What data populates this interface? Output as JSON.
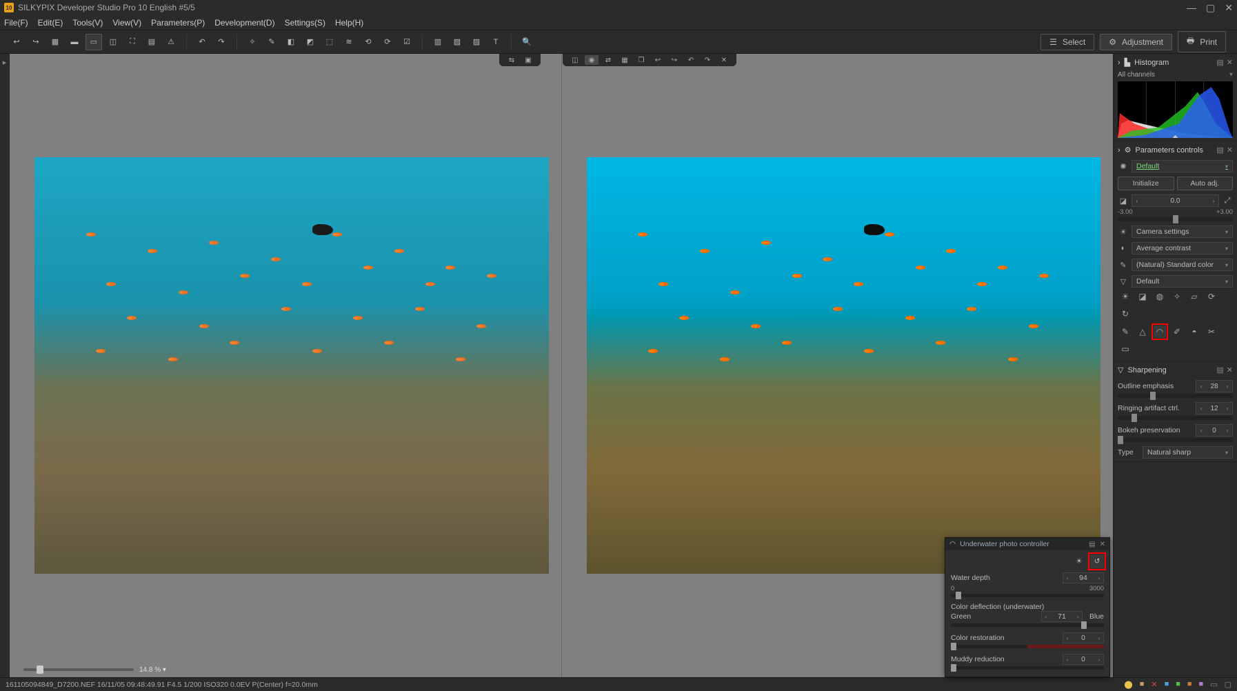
{
  "title": "SILKYPIX Developer Studio Pro 10 English   #5/5",
  "menu": [
    "File(F)",
    "Edit(E)",
    "Tools(V)",
    "View(V)",
    "Parameters(P)",
    "Development(D)",
    "Settings(S)",
    "Help(H)"
  ],
  "toolbar_right": {
    "select": "Select",
    "adjust": "Adjustment",
    "print": "Print"
  },
  "zoom": {
    "value": "14.8",
    "unit": "%"
  },
  "histogram": {
    "title": "Histogram",
    "channel": "All channels"
  },
  "params": {
    "title": "Parameters controls",
    "preset": "Default",
    "initialize": "Initialize",
    "autoadj": "Auto adj.",
    "exposure": {
      "value": "0.0",
      "min": "-3.00",
      "max": "+3.00"
    },
    "wb": "Camera settings",
    "tone": "Average contrast",
    "color": "(Natural) Standard color",
    "sharp_preset": "Default"
  },
  "sharpening": {
    "title": "Sharpening",
    "outline": {
      "label": "Outline emphasis",
      "value": "28"
    },
    "ringing": {
      "label": "Ringing artifact ctrl.",
      "value": "12"
    },
    "bokeh": {
      "label": "Bokeh preservation",
      "value": "0"
    },
    "type_label": "Type",
    "type_value": "Natural sharp"
  },
  "underwater": {
    "title": "Underwater photo controller",
    "depth": {
      "label": "Water depth",
      "value": "94",
      "min": "0",
      "max": "3000"
    },
    "deflect": {
      "label": "Color deflection (underwater)",
      "value": "71",
      "left": "Green",
      "right": "Blue"
    },
    "restore": {
      "label": "Color restoration",
      "value": "0"
    },
    "muddy": {
      "label": "Muddy reduction",
      "value": "0"
    }
  },
  "status": "161105094849_D7200.NEF 16/11/05 09:48:49.91 F4.5 1/200 ISO320  0.0EV P(Center) f=20.0mm"
}
